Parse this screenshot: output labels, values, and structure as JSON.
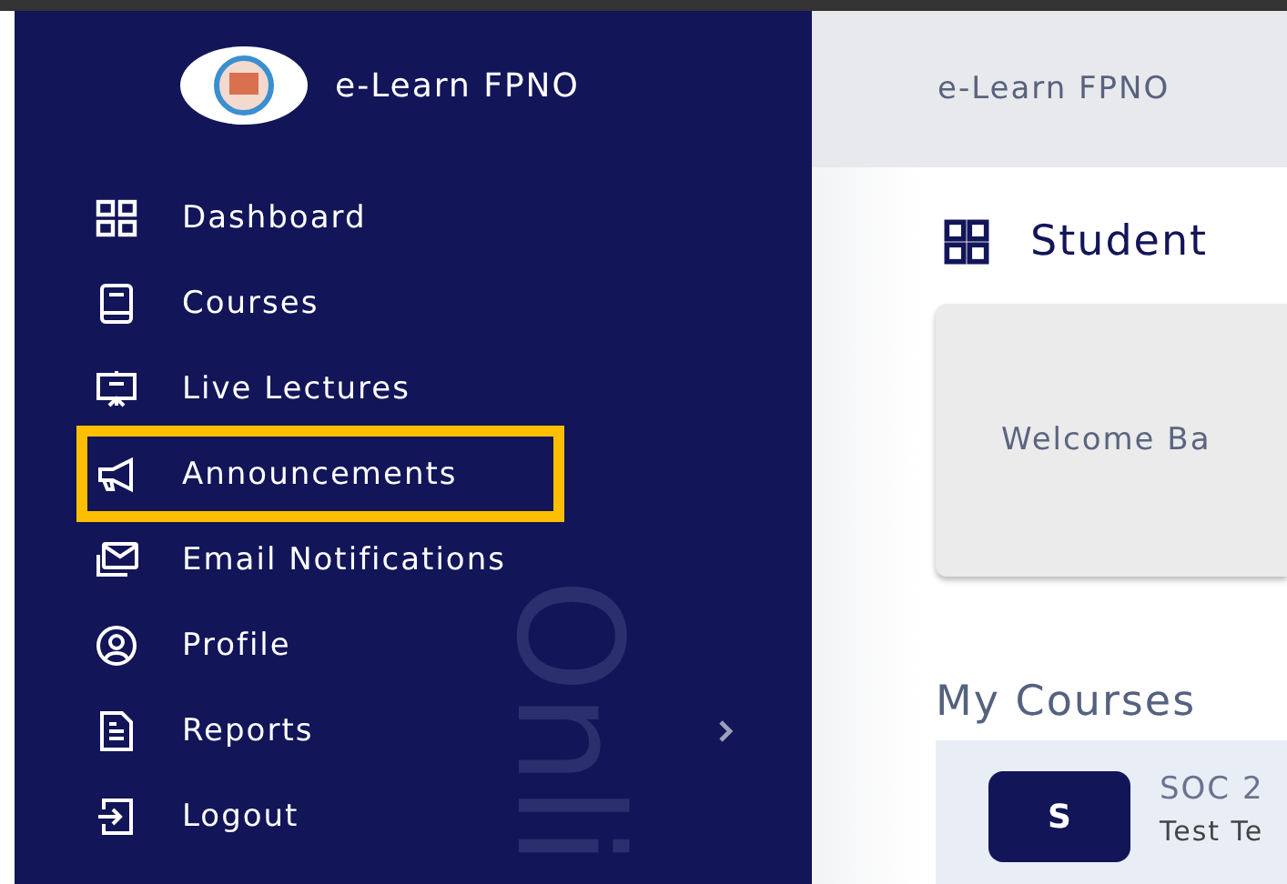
{
  "sidebar": {
    "brand": "e-Learn FPNO",
    "backdrop_text": "Onli",
    "items": [
      {
        "label": "Dashboard",
        "highlighted": false,
        "submenu": false
      },
      {
        "label": "Courses",
        "highlighted": false,
        "submenu": false
      },
      {
        "label": "Live Lectures",
        "highlighted": false,
        "submenu": false
      },
      {
        "label": "Announcements",
        "highlighted": true,
        "submenu": false
      },
      {
        "label": "Email Notifications",
        "highlighted": false,
        "submenu": false
      },
      {
        "label": "Profile",
        "highlighted": false,
        "submenu": false
      },
      {
        "label": "Reports",
        "highlighted": false,
        "submenu": true
      },
      {
        "label": "Logout",
        "highlighted": false,
        "submenu": false
      }
    ]
  },
  "header": {
    "title": "e-Learn FPNO"
  },
  "page": {
    "heading": "Student",
    "welcome": "Welcome Ba",
    "section": "My Courses",
    "courses": [
      {
        "initial": "S",
        "code": "SOC 2",
        "title": "Test Te"
      }
    ]
  }
}
